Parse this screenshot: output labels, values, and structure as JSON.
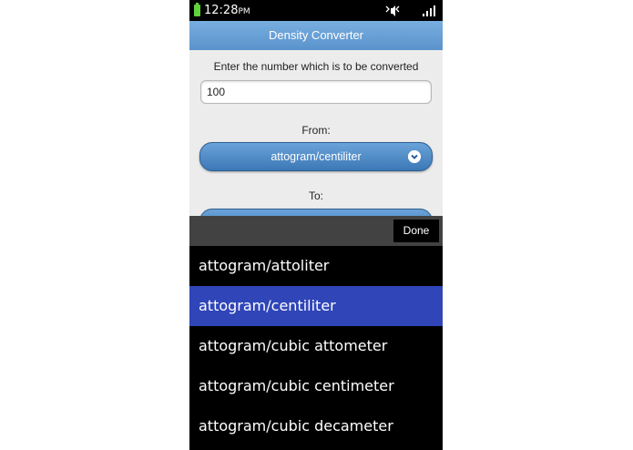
{
  "status_bar": {
    "time": "12:28",
    "ampm": "PM"
  },
  "app": {
    "title": "Density Converter"
  },
  "form": {
    "input_label": "Enter the number which is to be converted",
    "input_value": "100",
    "from_label": "From:",
    "from_value": "attogram/centiliter",
    "to_label": "To:"
  },
  "picker": {
    "done_label": "Done",
    "items": [
      {
        "label": "attogram/attoliter"
      },
      {
        "label": "attogram/centiliter"
      },
      {
        "label": "attogram/cubic attometer"
      },
      {
        "label": "attogram/cubic centimeter"
      },
      {
        "label": "attogram/cubic decameter"
      }
    ],
    "selected_label": "attogram/centiliter"
  },
  "colors": {
    "accent": "#4a86c5",
    "selected_row": "#2f45b8",
    "battery": "#5fd23c"
  },
  "icons": [
    "battery-icon",
    "mute-icon",
    "signal-icon",
    "chevron-down-icon"
  ]
}
